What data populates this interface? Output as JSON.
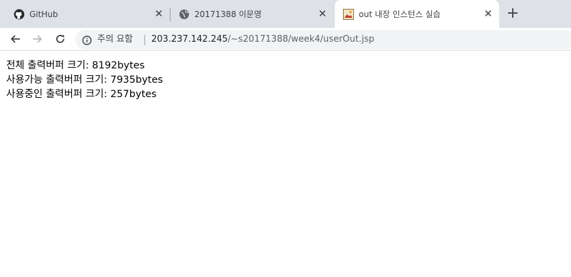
{
  "tabs": [
    {
      "title": "GitHub",
      "icon": "github-icon",
      "close": "✕"
    },
    {
      "title": "20171388 이문영",
      "icon": "globe-icon",
      "close": "✕"
    },
    {
      "title": "out 내장 인스턴스 실습",
      "icon": "page-favicon",
      "close": "✕",
      "active": true
    }
  ],
  "new_tab": "+",
  "address_bar": {
    "security_label": "주의 요함",
    "url_host": "203.237.142.245",
    "url_path": "/~s20171388/week4/userOut.jsp"
  },
  "page": {
    "lines": [
      "전체 출력버퍼 크기: 8192bytes",
      "사용가능 출력버퍼 크기: 7935bytes",
      "사용중인 출력버퍼 크기: 257bytes"
    ]
  },
  "colors": {
    "tabstrip": "#dee1e6",
    "active_tab": "#ffffff",
    "omnibox": "#f1f3f4"
  }
}
